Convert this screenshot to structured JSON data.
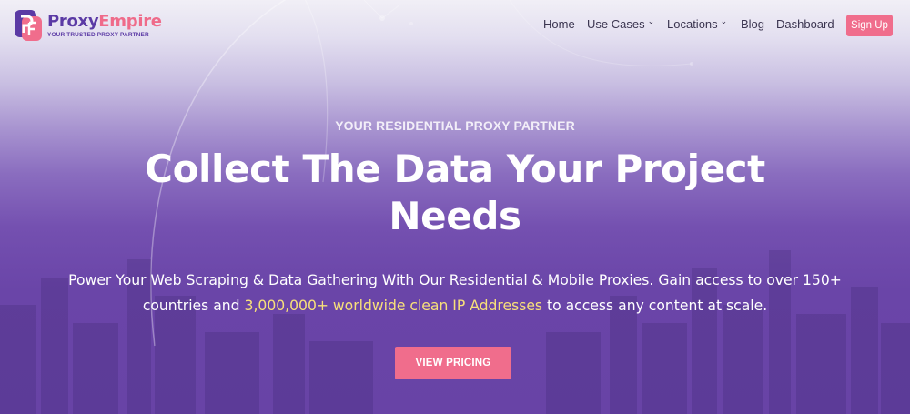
{
  "brand": {
    "name_part1": "Proxy",
    "name_part2": "Empire",
    "tagline": "YOUR TRUSTED PROXY PARTNER",
    "colors": {
      "purple": "#5b3aa5",
      "pink": "#f06d8c",
      "highlight": "#f8e07a"
    }
  },
  "nav": {
    "items": [
      {
        "label": "Home",
        "has_dropdown": false
      },
      {
        "label": "Use Cases",
        "has_dropdown": true
      },
      {
        "label": "Locations",
        "has_dropdown": true
      },
      {
        "label": "Blog",
        "has_dropdown": false
      },
      {
        "label": "Dashboard",
        "has_dropdown": false
      }
    ],
    "chevron": "⌄",
    "signup_label": "Sign Up"
  },
  "hero": {
    "eyebrow": "YOUR RESIDENTIAL PROXY PARTNER",
    "headline_line1": "Collect The Data Your Project",
    "headline_line2": "Needs",
    "desc_part1": "Power Your Web Scraping & Data Gathering  With Our Residential & Mobile Proxies. Gain access to over 150+ countries and ",
    "desc_highlight": "3,000,000+ worldwide clean IP Addresses",
    "desc_part2": " to access any content at scale.",
    "cta_label": "VIEW PRICING"
  }
}
